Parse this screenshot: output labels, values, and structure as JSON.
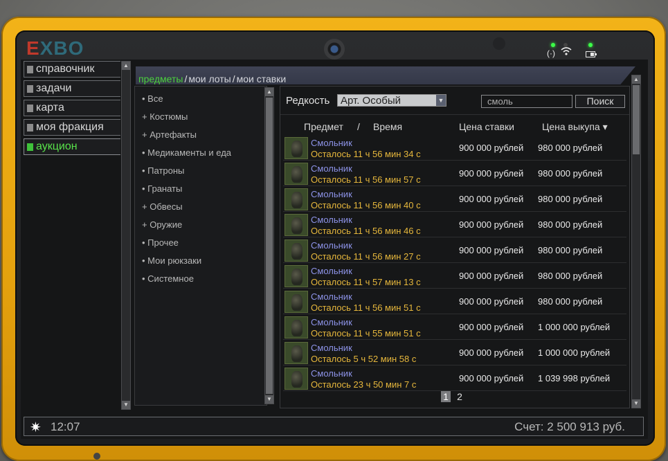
{
  "brand": {
    "e": "E",
    "rest": "XBO"
  },
  "sidebar": {
    "items": [
      {
        "label": "справочник",
        "active": false
      },
      {
        "label": "задачи",
        "active": false
      },
      {
        "label": "карта",
        "active": false
      },
      {
        "label": "моя фракция",
        "active": false
      },
      {
        "label": "аукцион",
        "active": true
      }
    ]
  },
  "tabs": {
    "items": [
      "предметы",
      "мои лоты",
      "мои ставки"
    ],
    "active": 0
  },
  "categories": [
    "• Все",
    "+ Костюмы",
    "+ Артефакты",
    "• Медикаменты и еда",
    "• Патроны",
    "• Гранаты",
    "+ Обвесы",
    "+ Оружие",
    "• Прочее",
    "• Мои рюкзаки",
    "• Системное"
  ],
  "filter": {
    "rarity_label": "Редкость",
    "rarity_value": "Арт. Особый",
    "search_value": "смоль",
    "search_button": "Поиск"
  },
  "columns": {
    "item": "Предмет",
    "slash": "/",
    "time": "Время",
    "bid": "Цена ставки",
    "buyout": "Цена выкупа ▾"
  },
  "lots": [
    {
      "name": "Смольник",
      "time": "Осталось 11 ч 56 мин 34 с",
      "bid": "900 000 рублей",
      "buyout": "980 000 рублей"
    },
    {
      "name": "Смольник",
      "time": "Осталось 11 ч 56 мин 57 с",
      "bid": "900 000 рублей",
      "buyout": "980 000 рублей"
    },
    {
      "name": "Смольник",
      "time": "Осталось 11 ч 56 мин 40 с",
      "bid": "900 000 рублей",
      "buyout": "980 000 рублей"
    },
    {
      "name": "Смольник",
      "time": "Осталось 11 ч 56 мин 46 с",
      "bid": "900 000 рублей",
      "buyout": "980 000 рублей"
    },
    {
      "name": "Смольник",
      "time": "Осталось 11 ч 56 мин 27 с",
      "bid": "900 000 рублей",
      "buyout": "980 000 рублей"
    },
    {
      "name": "Смольник",
      "time": "Осталось 11 ч 57 мин 13 с",
      "bid": "900 000 рублей",
      "buyout": "980 000 рублей"
    },
    {
      "name": "Смольник",
      "time": "Осталось 11 ч 56 мин 51 с",
      "bid": "900 000 рублей",
      "buyout": "980 000 рублей"
    },
    {
      "name": "Смольник",
      "time": "Осталось 11 ч 55 мин 51 с",
      "bid": "900 000 рублей",
      "buyout": "1 000 000 рублей"
    },
    {
      "name": "Смольник",
      "time": "Осталось 5 ч 52 мин 58 с",
      "bid": "900 000 рублей",
      "buyout": "1 000 000 рублей"
    },
    {
      "name": "Смольник",
      "time": "Осталось 23 ч 50 мин 7 с",
      "bid": "900 000 рублей",
      "buyout": "1 039 998 рублей"
    }
  ],
  "pager": {
    "pages": [
      "1",
      "2"
    ],
    "current": "1"
  },
  "footer": {
    "time": "12:07",
    "balance": "Счет: 2 500 913 руб."
  },
  "colors": {
    "accent_green": "#4cd13e",
    "item_name": "#8d93e8",
    "time_left": "#e6b73c",
    "tablet_yellow": "#f2b318"
  }
}
